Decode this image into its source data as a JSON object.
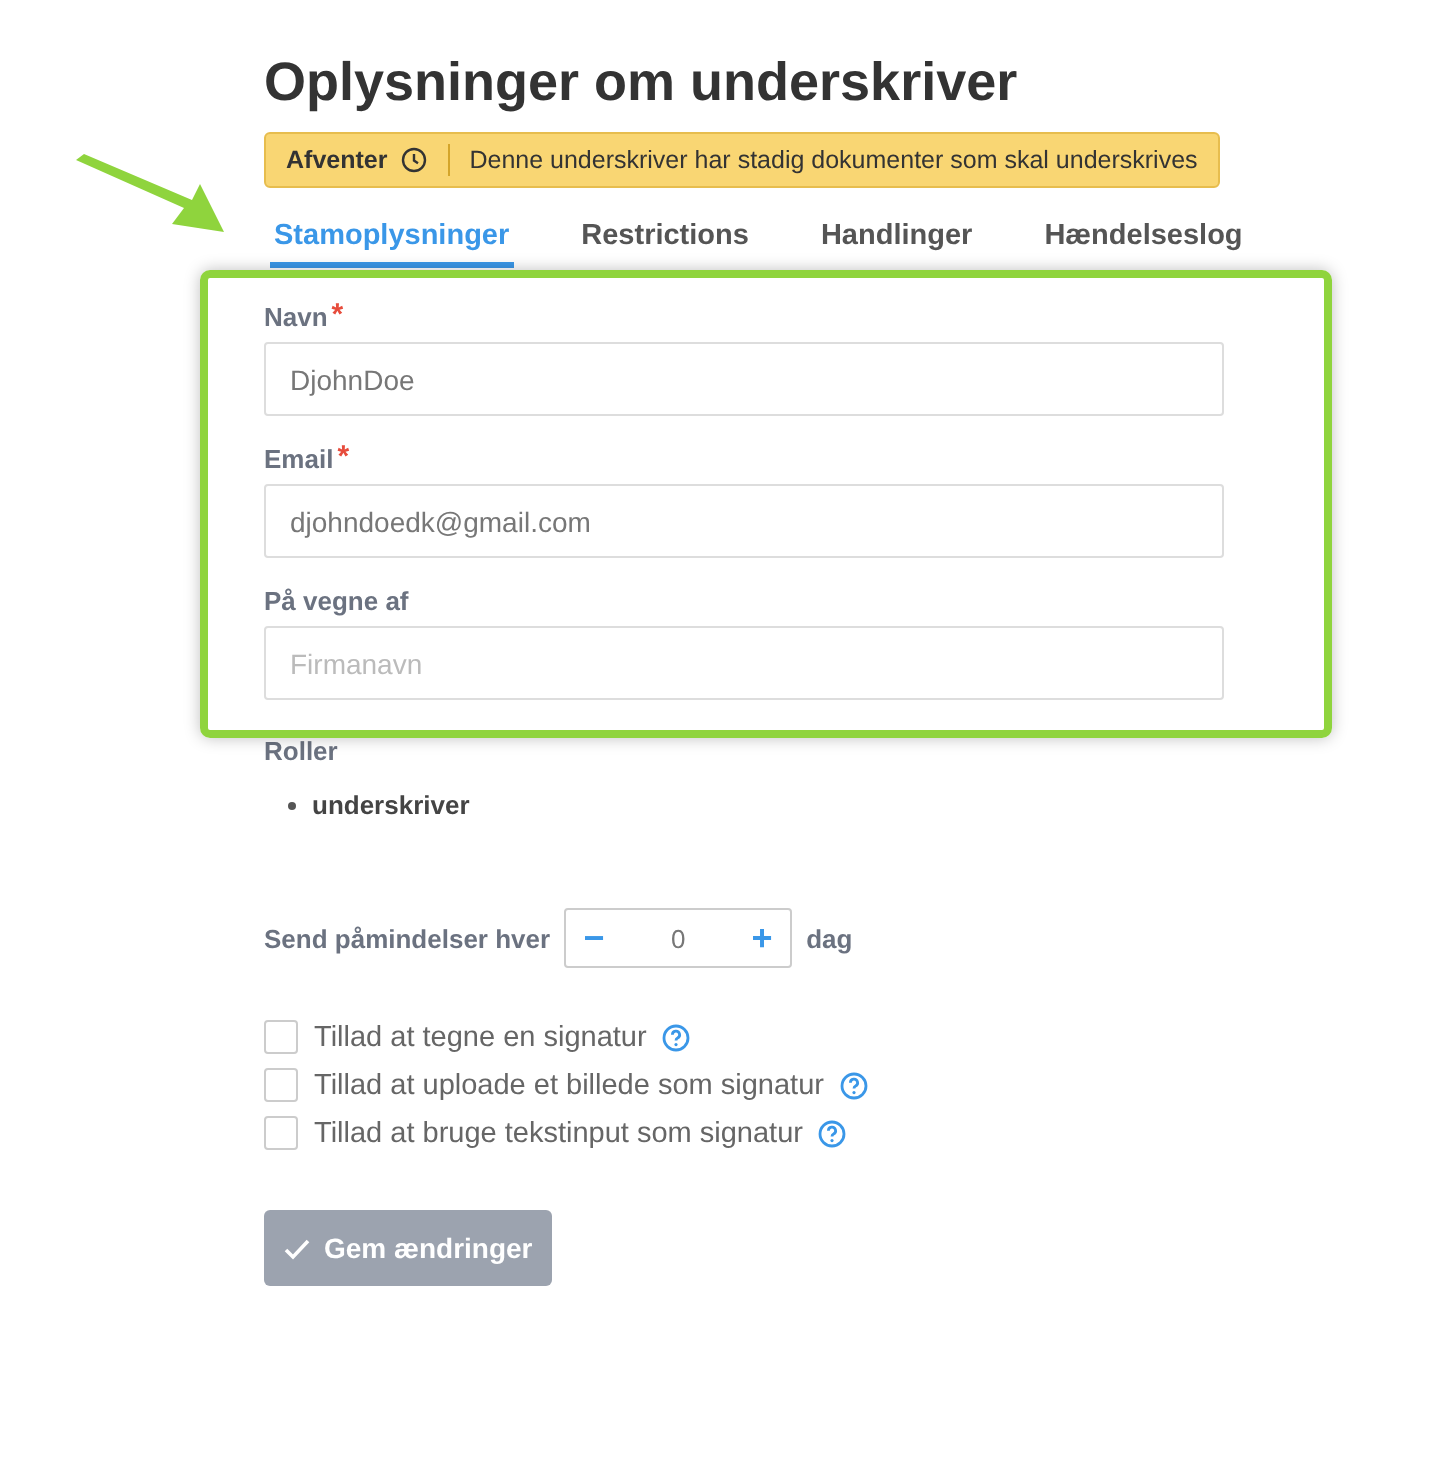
{
  "title": "Oplysninger om underskriver",
  "status_banner": {
    "status": "Afventer",
    "message": "Denne underskriver har stadig dokumenter som skal underskrives"
  },
  "tabs": [
    {
      "label": "Stamoplysninger",
      "selected": true
    },
    {
      "label": "Restrictions",
      "selected": false
    },
    {
      "label": "Handlinger",
      "selected": false
    },
    {
      "label": "Hændelseslog",
      "selected": false
    }
  ],
  "fields": [
    {
      "label": "Navn",
      "required": true,
      "value": "DjohnDoe"
    },
    {
      "label": "Email",
      "required": true,
      "value": "djohndoedk@gmail.com"
    },
    {
      "label": "På vegne af",
      "required": false,
      "placeholder": "Firmanavn"
    }
  ],
  "required_mark": "*",
  "roles": {
    "label": "Roller",
    "items": [
      "underskriver"
    ]
  },
  "reminder": {
    "label": "Send påmindelser hver",
    "minus": "−",
    "value": "0",
    "plus": "+",
    "unit": "dag"
  },
  "options": [
    {
      "label": "Tillad at tegne en signatur",
      "checked": false
    },
    {
      "label": "Tillad at uploade et billede som signatur",
      "checked": false
    },
    {
      "label": "Tillad at bruge tekstinput som signatur",
      "checked": false
    }
  ],
  "save_button": {
    "label": "Gem ændringer",
    "disabled": true
  }
}
